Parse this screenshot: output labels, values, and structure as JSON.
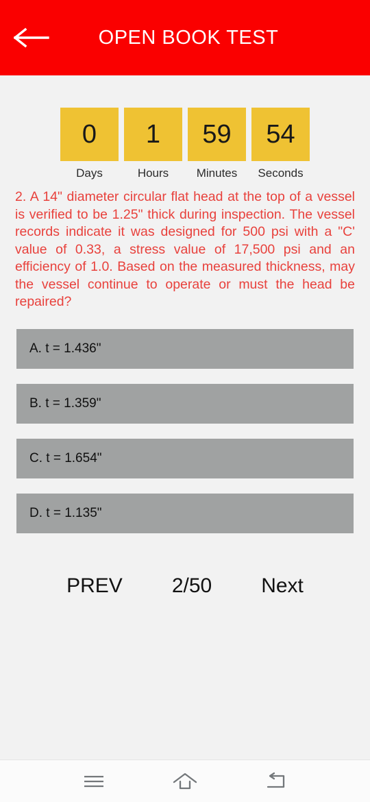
{
  "header": {
    "title": "OPEN BOOK TEST",
    "back_icon": "back-arrow-icon",
    "bg_color": "#FA0000",
    "text_color": "#FFFFFF"
  },
  "timer": {
    "accent_color": "#EFC233",
    "cells": [
      {
        "value": "0",
        "label": "Days"
      },
      {
        "value": "1",
        "label": "Hours"
      },
      {
        "value": "59",
        "label": "Minutes"
      },
      {
        "value": "54",
        "label": "Seconds"
      }
    ]
  },
  "question": {
    "color": "#E8413C",
    "text": "2. A 14\" diameter circular flat head at the top of a vessel is verified to be 1.25\" thick during inspection. The vessel records indicate it was designed for 500 psi with a \"C' value of 0.33, a stress value of 17,500 psi and an efficiency of 1.0. Based on the measured thickness, may the vessel continue to operate or must the head be repaired?"
  },
  "options": {
    "bg_color": "#A0A2A2",
    "items": [
      {
        "label": "A. t = 1.436\""
      },
      {
        "label": "B. t = 1.359\""
      },
      {
        "label": "C. t = 1.654\""
      },
      {
        "label": "D. t = 1.135\""
      }
    ]
  },
  "navigation": {
    "prev_label": "PREV",
    "counter": "2/50",
    "next_label": "Next"
  },
  "system_bar": {
    "buttons": [
      {
        "icon": "menu-icon"
      },
      {
        "icon": "home-icon"
      },
      {
        "icon": "back-icon"
      }
    ]
  }
}
